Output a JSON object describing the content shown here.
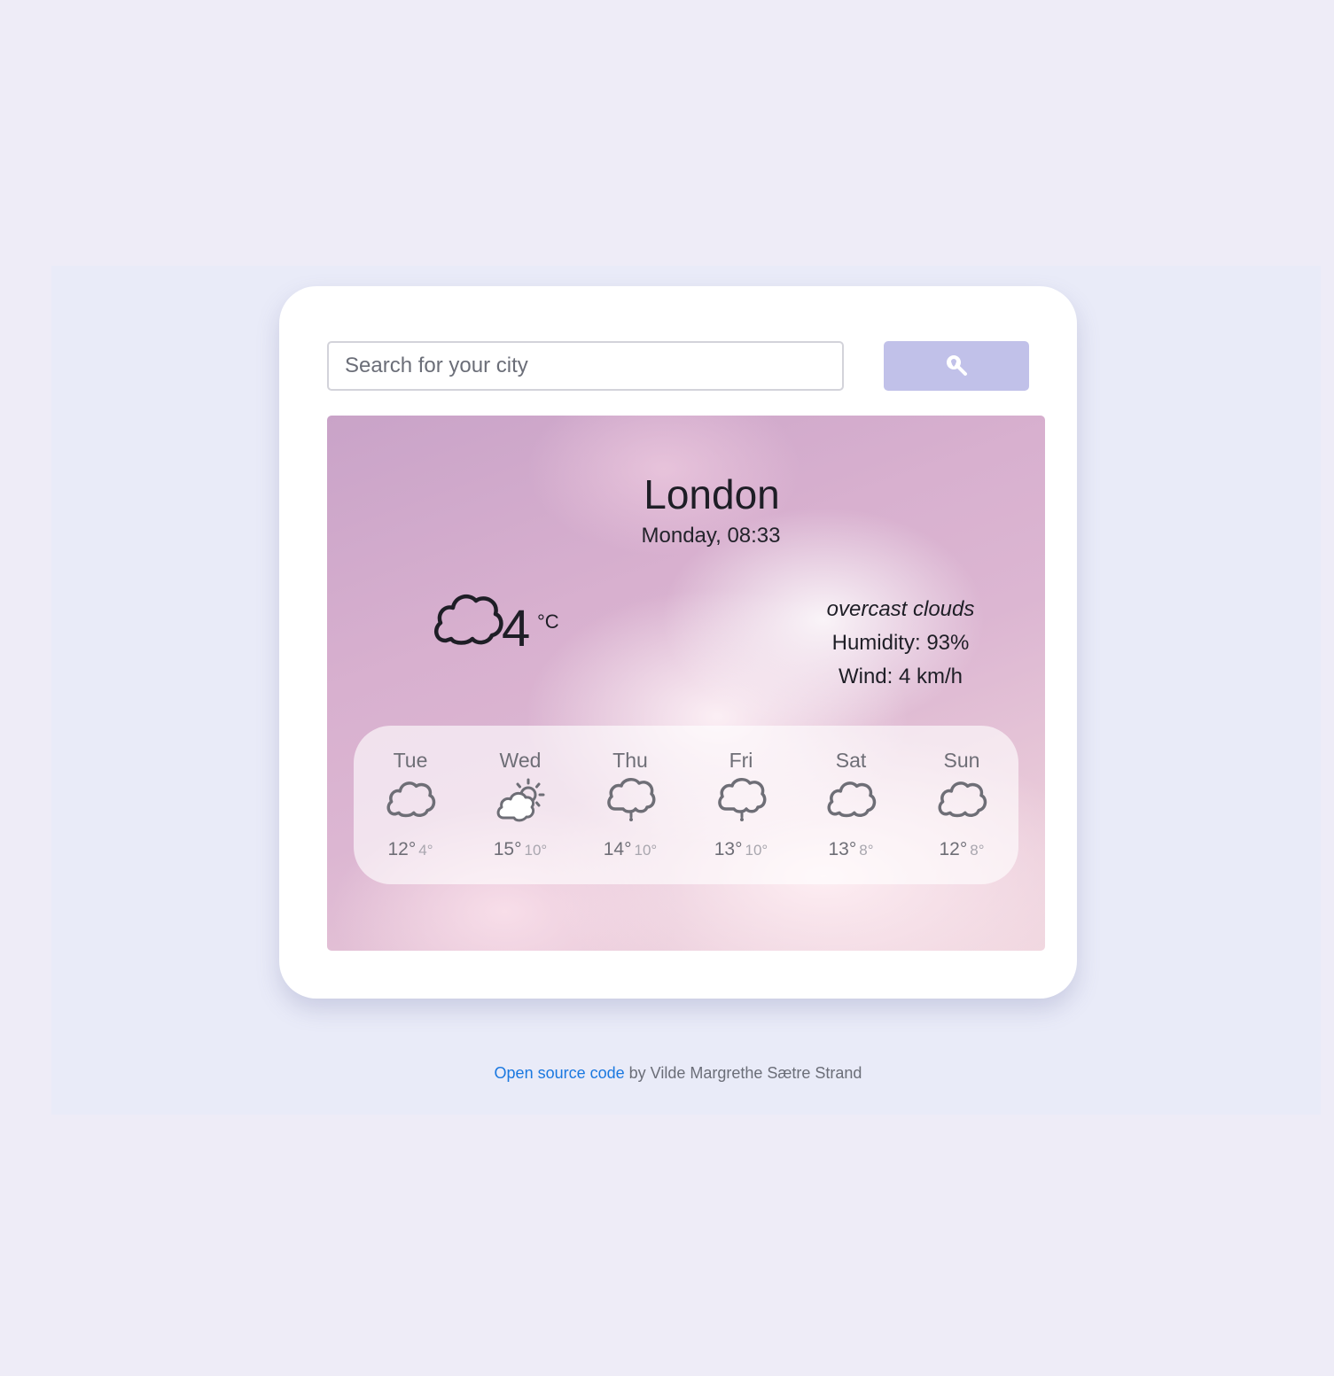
{
  "search": {
    "placeholder": "Search for your city",
    "button_icon": "search-location-icon",
    "button_color": "#c1c1e9"
  },
  "current": {
    "city": "London",
    "datetime": "Monday, 08:33",
    "icon": "cloud-icon",
    "temperature": "4",
    "unit": "°C",
    "description": "overcast clouds",
    "humidity": "Humidity: 93%",
    "wind": "Wind: 4 km/h"
  },
  "forecast": [
    {
      "day": "Tue",
      "icon": "cloud-icon",
      "high": "12°",
      "low": "4°"
    },
    {
      "day": "Wed",
      "icon": "sun-cloud-icon",
      "high": "15°",
      "low": "10°"
    },
    {
      "day": "Thu",
      "icon": "rain-cloud-icon",
      "high": "14°",
      "low": "10°"
    },
    {
      "day": "Fri",
      "icon": "rain-cloud-icon",
      "high": "13°",
      "low": "10°"
    },
    {
      "day": "Sat",
      "icon": "cloud-icon",
      "high": "13°",
      "low": "8°"
    },
    {
      "day": "Sun",
      "icon": "cloud-icon",
      "high": "12°",
      "low": "8°"
    }
  ],
  "footer": {
    "link_text": "Open source code",
    "by_text": " by Vilde Margrethe Sætre Strand",
    "link_color": "#1a78e0"
  }
}
